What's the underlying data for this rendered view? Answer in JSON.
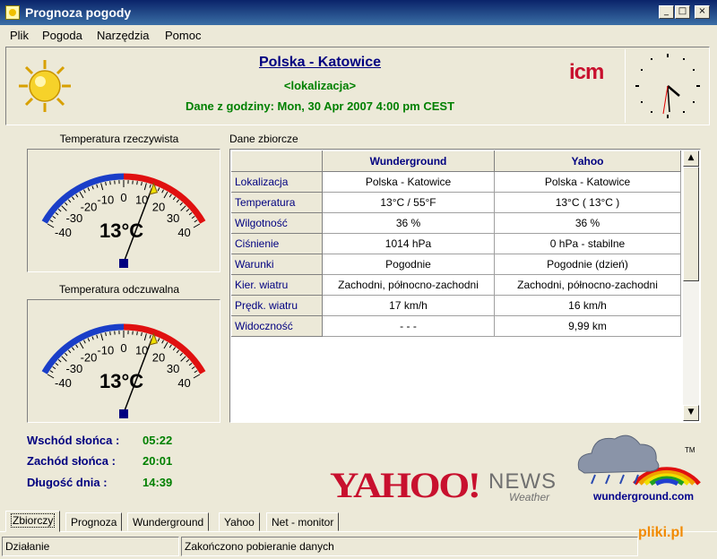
{
  "window": {
    "title": "Prognoza pogody"
  },
  "menu": [
    "Plik",
    "Pogoda",
    "Narzędzia",
    "Pomoc"
  ],
  "header": {
    "location": "Polska - Katowice",
    "location_sub": "<lokalizacja>",
    "data_time": "Dane z godziny: Mon, 30 Apr 2007 4:00 pm CEST",
    "logo_text": "icm"
  },
  "gauges": [
    {
      "title": "Temperatura rzeczywista",
      "value": 13,
      "value_text": "13°C",
      "ticks": [
        "-40",
        "-30",
        "-20",
        "-10",
        "0",
        "10",
        "20",
        "30",
        "40"
      ]
    },
    {
      "title": "Temperatura odczuwalna",
      "value": 13,
      "value_text": "13°C",
      "ticks": [
        "-40",
        "-30",
        "-20",
        "-10",
        "0",
        "10",
        "20",
        "30",
        "40"
      ]
    }
  ],
  "sun": [
    {
      "label": "Wschód słońca :",
      "value": "05:22"
    },
    {
      "label": "Zachód słońca :",
      "value": "20:01"
    },
    {
      "label": "Długość dnia :",
      "value": "14:39"
    }
  ],
  "table": {
    "label": "Dane zbiorcze",
    "columns": [
      "Wunderground",
      "Yahoo"
    ],
    "rows": [
      {
        "name": "Lokalizacja",
        "wu": "Polska - Katowice",
        "yahoo": "Polska - Katowice"
      },
      {
        "name": "Temperatura",
        "wu": "13°C / 55°F",
        "yahoo": "13°C  ( 13°C )"
      },
      {
        "name": "Wilgotność",
        "wu": "36 %",
        "yahoo": "36 %"
      },
      {
        "name": "Ciśnienie",
        "wu": "1014 hPa",
        "yahoo": "0 hPa - stabilne"
      },
      {
        "name": "Warunki",
        "wu": "Pogodnie",
        "yahoo": "Pogodnie (dzień)"
      },
      {
        "name": "Kier. wiatru",
        "wu": "Zachodni, północno-zachodni",
        "yahoo": "Zachodni, północno-zachodni"
      },
      {
        "name": "Prędk. wiatru",
        "wu": "17 km/h",
        "yahoo": "16 km/h"
      },
      {
        "name": "Widoczność",
        "wu": "- - -",
        "yahoo": "9,99 km"
      }
    ]
  },
  "logos": {
    "yahoo": "YAHOO!",
    "news": "NEWS",
    "weather": "Weather",
    "wunderground": "wunderground.com",
    "tm": "TM"
  },
  "tabs": [
    "Zbiorczy",
    "Prognoza",
    "Wunderground",
    "Yahoo",
    "Net - monitor"
  ],
  "status": {
    "left": "Działanie",
    "right": "Zakończono pobieranie danych"
  },
  "watermark": {
    "a": "pliki",
    "b": ".pl"
  },
  "colors": {
    "cold_arc": "#1a3ec8",
    "warm_arc": "#e01010",
    "label_blue": "#000080",
    "label_green": "#008000"
  }
}
